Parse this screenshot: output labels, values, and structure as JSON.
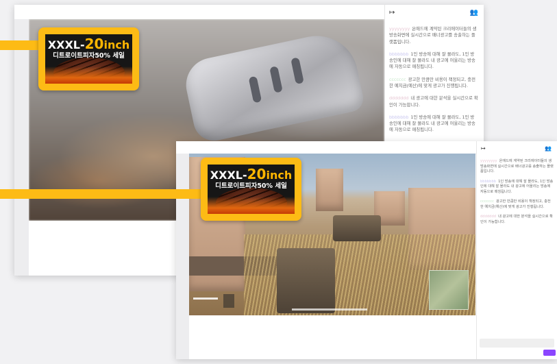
{
  "chat1": {
    "messages": [
      {
        "user": "yyyyyyyy",
        "user_color": "#e7c7d4",
        "text": "온애드에 계약된 크리에이터들의 생방송화면에 실시간으로 배너광고를 송출하는 플랫폼입니다."
      },
      {
        "user": "bbbbbbb",
        "user_color": "#c9c7ef",
        "text": "1인 방송에 대해 잘 몰라도, 1인 방송인에 대해 잘 몰라도 내 광고에 어울리는 방송에 자동으로 매칭됩니다."
      },
      {
        "user": "ccccccc",
        "user_color": "#c5e7c9",
        "text": "광고한 만큼만 비용이 책정되고, 충전한 예치금(예산)에 맞게 광고가 진행됩니다."
      },
      {
        "user": "ddddddd",
        "user_color": "#e7c7d4",
        "text": "내 광고에 대한 분석을 실시간으로 확인이 가능합니다."
      },
      {
        "user": "bbbbbbb",
        "user_color": "#c9c7ef",
        "text": "1인 방송에 대해 잘 몰라도, 1인 방송인에 대해 잘 몰라도 내 광고에 어울리는 방송에 자동으로 매칭됩니다."
      }
    ]
  },
  "chat2": {
    "messages": [
      {
        "user": "yyyyyyyy",
        "user_color": "#e7c7d4",
        "text": "온애드에 계약된 크리에이터들의 생방송화면에 실시간으로 배너광고를 송출하는 플랫폼입니다."
      },
      {
        "user": "bbbbbbb",
        "user_color": "#c9c7ef",
        "text": "1인 방송에 대해 잘 몰라도, 1인 방송인에 대해 잘 몰라도 내 광고에 어울리는 방송에 자동으로 매칭됩니다."
      },
      {
        "user": "ccccccc",
        "user_color": "#c5e7c9",
        "text": "광고한 만큼만 비용이 책정되고, 충전한 예치금(예산)에 맞게 광고가 진행됩니다."
      },
      {
        "user": "ddddddd",
        "user_color": "#e7c7d4",
        "text": "내 광고에 대한 분석을 실시간으로 확인이 가능합니다."
      }
    ]
  },
  "banner": {
    "title_part1": "XXXL-",
    "title_part2": "20",
    "title_part3": "inch",
    "subtitle": "디트로이트피자50% 세일"
  },
  "icons": {
    "collapse": "collapse-chat-icon",
    "users": "users-icon"
  },
  "colors": {
    "banner_yellow": "#fdbb15",
    "send_button": "#8b45ff"
  }
}
